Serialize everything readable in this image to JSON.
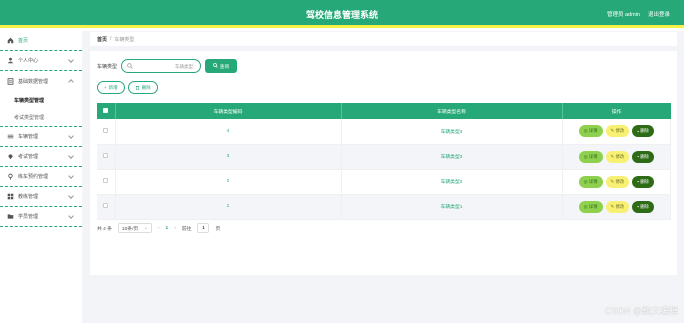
{
  "header": {
    "title": "驾校信息管理系统",
    "user": "管理员 admin",
    "logout": "退出登录"
  },
  "sidebar": {
    "items": [
      {
        "label": "首页",
        "icon": "home-icon"
      },
      {
        "label": "个人中心",
        "icon": "user-icon"
      },
      {
        "label": "基础数据管理",
        "icon": "database-icon"
      },
      {
        "label": "车辆管理",
        "icon": "car-icon"
      },
      {
        "label": "考试管理",
        "icon": "location-icon"
      },
      {
        "label": "练车预约管理",
        "icon": "pin-icon"
      },
      {
        "label": "教练管理",
        "icon": "grid-icon"
      },
      {
        "label": "学员管理",
        "icon": "folder-icon"
      }
    ],
    "sub_items": [
      "车辆类型管理",
      "考试类型管理"
    ]
  },
  "breadcrumb": {
    "home": "首页",
    "sep": "/",
    "current": "车辆类型"
  },
  "search": {
    "label": "车辆类型",
    "placeholder": "车辆类型",
    "button": "查询"
  },
  "actions": {
    "add": "新增",
    "delete": "删除"
  },
  "table": {
    "headers": [
      "车辆类型编码",
      "车辆类型名称",
      "操作"
    ],
    "rows": [
      {
        "code": "4",
        "name": "车辆类型4"
      },
      {
        "code": "3",
        "name": "车辆类型3"
      },
      {
        "code": "2",
        "name": "车辆类型2"
      },
      {
        "code": "1",
        "name": "车辆类型1"
      }
    ],
    "ops": {
      "detail": "详情",
      "edit": "修改",
      "delete": "删除"
    }
  },
  "pagination": {
    "total": "共 4 条",
    "page_size": "10条/页",
    "current": "1",
    "goto_label": "前往",
    "goto_value": "1",
    "page_unit": "页"
  },
  "watermark": "CSDN @黯文编程",
  "colors": {
    "primary": "#27a879",
    "accent": "#f4f14a"
  }
}
